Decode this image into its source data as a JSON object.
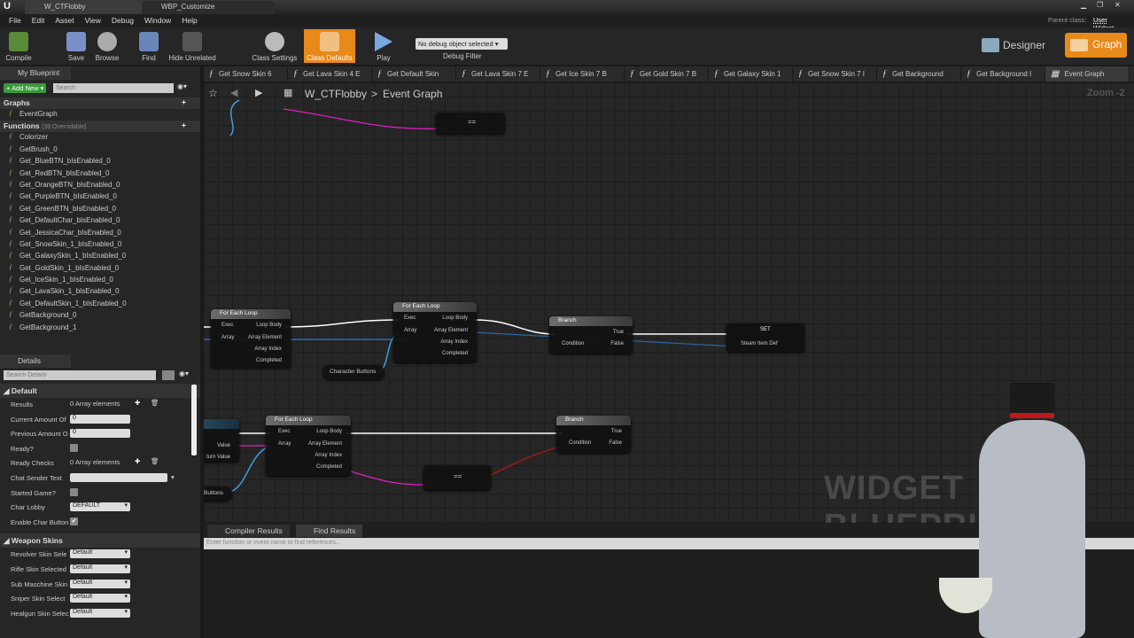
{
  "window": {
    "tabs": [
      "W_CTFlobby",
      "WBP_Customize"
    ],
    "parent_class_label": "Parent class:",
    "parent_class": "User Widget"
  },
  "menu": [
    "File",
    "Edit",
    "Asset",
    "View",
    "Debug",
    "Window",
    "Help"
  ],
  "toolbar": {
    "compile": "Compile",
    "save": "Save",
    "browse": "Browse",
    "find": "Find",
    "hide_unrelated": "Hide Unrelated",
    "class_settings": "Class Settings",
    "class_defaults": "Class Defaults",
    "play": "Play",
    "debug_select": "No debug object selected ▾",
    "debug_filter": "Debug Filter",
    "designer": "Designer",
    "graph": "Graph"
  },
  "graph_tabs": [
    "Get Snow Skin 6",
    "Get Lava Skin 4 E",
    "Get Default Skin",
    "Get Lava Skin 7 E",
    "Get Ice Skin 7 B",
    "Get Gold Skin 7 B",
    "Get Galaxy Skin 1",
    "Get Snow Skin 7 I",
    "Get Background",
    "Get Background I",
    "Event Graph"
  ],
  "breadcrumb": {
    "root": "W_CTFlobby",
    "sep": ">",
    "current": "Event Graph"
  },
  "zoom": "Zoom -2",
  "my_blueprint": {
    "title": "My Blueprint",
    "add_new": "+ Add New ▾",
    "search_placeholder": "Search",
    "graphs_label": "Graphs",
    "event_graph": "EventGraph",
    "functions_label": "Functions",
    "functions_count": "(38 Overridable)",
    "functions": [
      "Colorizer",
      "GetBrush_0",
      "Get_BlueBTN_bIsEnabled_0",
      "Get_RedBTN_bIsEnabled_0",
      "Get_OrangeBTN_bIsEnabled_0",
      "Get_PurpleBTN_bIsEnabled_0",
      "Get_GreenBTN_bIsEnabled_0",
      "Get_DefaultChar_bIsEnabled_0",
      "Get_JessicaChar_bIsEnabled_0",
      "Get_SnowSkin_1_bIsEnabled_0",
      "Get_GalaxySkin_1_bIsEnabled_0",
      "Get_GoldSkin_1_bIsEnabled_0",
      "Get_IceSkin_1_bIsEnabled_0",
      "Get_LavaSkin_1_bIsEnabled_0",
      "Get_DefaultSkin_1_bIsEnabled_0",
      "GetBackground_0",
      "GetBackground_1"
    ]
  },
  "details": {
    "title": "Details",
    "search_placeholder": "Search Details",
    "default_label": "Default",
    "rows": [
      {
        "label": "Results",
        "value": "0 Array elements",
        "kind": "array"
      },
      {
        "label": "Current Amount Of",
        "value": "0",
        "kind": "input"
      },
      {
        "label": "Previous Amount O",
        "value": "0",
        "kind": "input"
      },
      {
        "label": "Ready?",
        "value": "",
        "kind": "check"
      },
      {
        "label": "Ready Checks",
        "value": "0 Array elements",
        "kind": "array"
      },
      {
        "label": "Chat Sender Text",
        "value": "",
        "kind": "text"
      },
      {
        "label": "Started Game?",
        "value": "",
        "kind": "check"
      },
      {
        "label": "Char Lobby",
        "value": "DEFAULT",
        "kind": "dropdown"
      },
      {
        "label": "Enable Char Button",
        "value": "✔",
        "kind": "checked"
      }
    ],
    "weapon_label": "Weapon Skins",
    "weapon_rows": [
      {
        "label": "Revolver Skin Sele",
        "value": "Default"
      },
      {
        "label": "Rifle Skin Selected",
        "value": "Default"
      },
      {
        "label": "Sub Maschine Skin",
        "value": "Default"
      },
      {
        "label": "Sniper Skin Select",
        "value": "Default"
      },
      {
        "label": "Healgun Skin Selec",
        "value": "Default"
      }
    ]
  },
  "nodes": {
    "foreach": "For Each Loop",
    "exec": "Exec",
    "array": "Array",
    "loop_body": "Loop Body",
    "array_element": "Array Element",
    "array_index": "Array Index",
    "completed": "Completed",
    "branch": "Branch",
    "true": "True",
    "false": "False",
    "condition": "Condition",
    "set": "SET",
    "steam_item_def": "Steam Item Def",
    "character_buttons": "Character Buttons",
    "buttons": "Buttons",
    "value": "Value",
    "return_value": "turn Value",
    "equals": "=="
  },
  "bottom": {
    "compiler_results": "Compiler Results",
    "find_results": "Find Results",
    "find_placeholder": "Enter function or event name to find references..."
  },
  "watermark": "WIDGET BLUEPRINT",
  "colors": {
    "accent": "#e8891b",
    "exec": "#ffffff",
    "object_pin": "#2f7fd8",
    "bool_pin": "#b0141a",
    "struct_pin": "#e020c0",
    "int_pin": "#3fbf6a"
  }
}
